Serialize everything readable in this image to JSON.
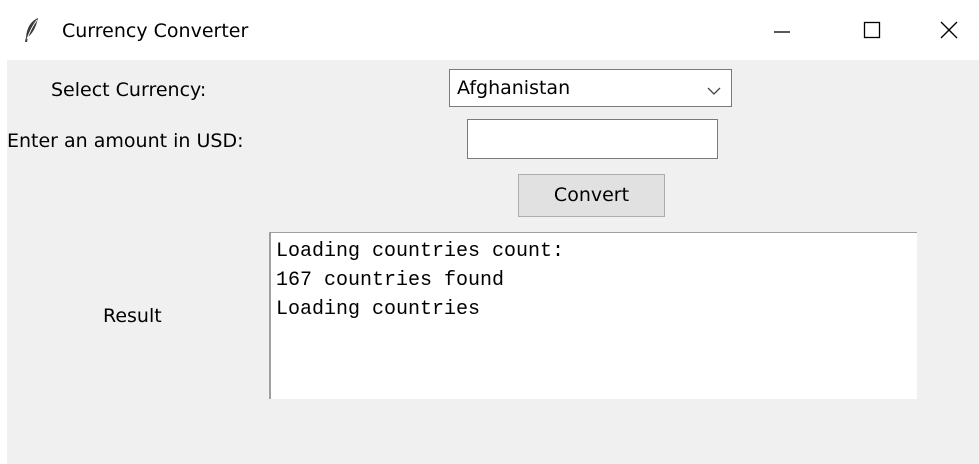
{
  "window": {
    "title": "Currency Converter",
    "icon": "feather-icon",
    "controls": {
      "minimize_icon": "minimize-icon",
      "maximize_icon": "maximize-icon",
      "close_icon": "close-icon"
    }
  },
  "form": {
    "currency_label": "Select Currency:",
    "currency_selected": "Afghanistan",
    "amount_label": "Enter an amount in USD:",
    "amount_value": "",
    "convert_label": "Convert",
    "result_label": "Result"
  },
  "result": {
    "lines": [
      "Loading countries count:",
      "167 countries found",
      "Loading countries"
    ]
  },
  "colors": {
    "client_background": "#f0f0f0",
    "button_background": "#e1e1e1",
    "field_border": "#7a7a7a"
  }
}
